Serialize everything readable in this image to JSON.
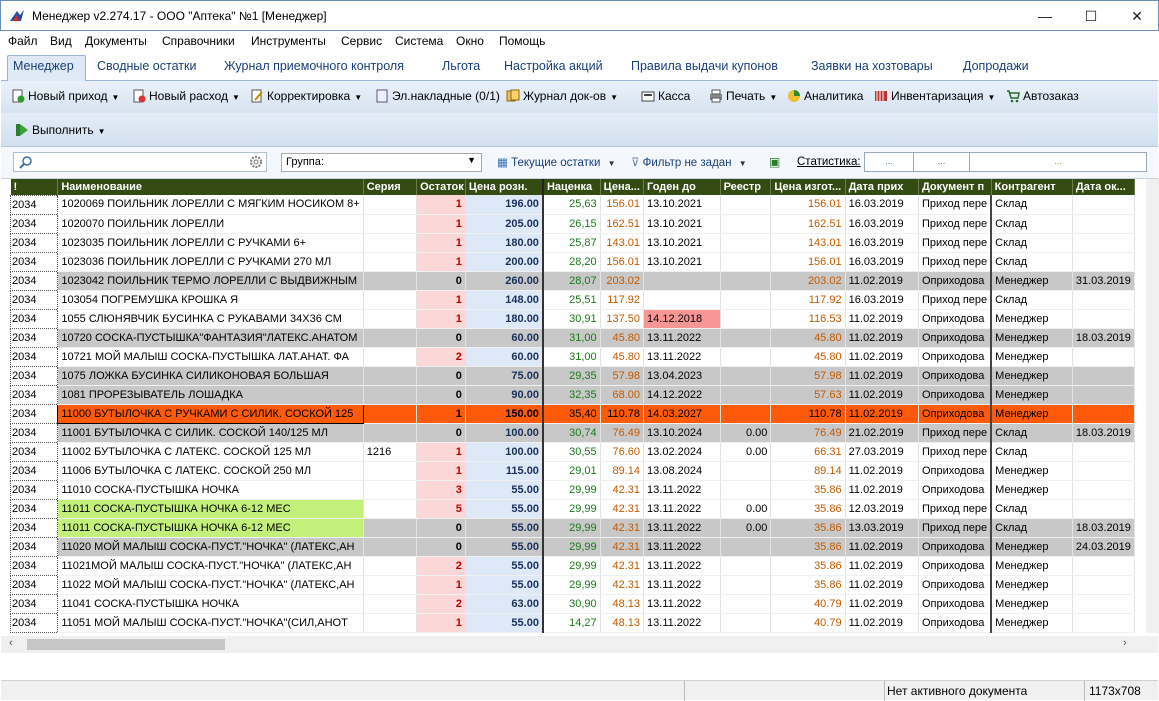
{
  "window": {
    "title": "Менеджер v2.274.17 - ООО \"Аптека\" №1 [Менеджер]",
    "minimize": "—",
    "maximize": "☐",
    "close": "✕"
  },
  "menu": [
    "Файл",
    "Вид",
    "Документы",
    "Справочники",
    "Инструменты",
    "Сервис",
    "Система",
    "Окно",
    "Помощь"
  ],
  "tabs": [
    "Менеджер",
    "Сводные остатки",
    "Журнал приемочного контроля",
    "Льгота",
    "Настройка акций",
    "Правила выдачи купонов",
    "Заявки на хозтовары",
    "Допродажи"
  ],
  "toolbar": {
    "new_income": "Новый приход",
    "new_expense": "Новый расход",
    "correction": "Корректировка",
    "el_invoices": "Эл.накладные (0/1)",
    "doc_journal": "Журнал док-ов",
    "cash": "Касса",
    "print": "Печать",
    "analytics": "Аналитика",
    "inventory": "Инвентаризация",
    "autoorder": "Автозаказ",
    "execute": "Выполнить"
  },
  "filters": {
    "search_value": "",
    "group_label": "Группа:",
    "current_stock": "Текущие остатки",
    "filter": "Фильтр не задан",
    "stats_label": "Статистика:",
    "stat1": "...",
    "stat2": "...",
    "stat3": "..."
  },
  "columns": [
    "!",
    "Наименование",
    "Серия",
    "Остаток",
    "Цена розн.",
    "Наценка",
    "Цена...",
    "Годен до",
    "Реестр",
    "Цена изгот...",
    "Дата прих",
    "Документ п",
    "Контрагент",
    "Дата ок..."
  ],
  "rows": [
    {
      "flag": "2034",
      "name": "1020069 ПОИЛЬНИК ЛОРЕЛЛИ С МЯГКИМ НОСИКОМ 8+",
      "series": "",
      "stock": "1",
      "price": "196.00",
      "markup": "25,63",
      "cost": "156.01",
      "expiry": "13.10.2021",
      "reg": "",
      "mprice": "156.01",
      "date": "16.03.2019",
      "doc": "Приход пере",
      "agent": "Склад",
      "dok": "",
      "style": ""
    },
    {
      "flag": "2034",
      "name": "1020070 ПОИЛЬНИК ЛОРЕЛЛИ",
      "series": "",
      "stock": "1",
      "price": "205.00",
      "markup": "26,15",
      "cost": "162.51",
      "expiry": "13.10.2021",
      "reg": "",
      "mprice": "162.51",
      "date": "16.03.2019",
      "doc": "Приход пере",
      "agent": "Склад",
      "dok": "",
      "style": ""
    },
    {
      "flag": "2034",
      "name": "1023035 ПОИЛЬНИК ЛОРЕЛЛИ С РУЧКАМИ 6+",
      "series": "",
      "stock": "1",
      "price": "180.00",
      "markup": "25,87",
      "cost": "143.01",
      "expiry": "13.10.2021",
      "reg": "",
      "mprice": "143.01",
      "date": "16.03.2019",
      "doc": "Приход пере",
      "agent": "Склад",
      "dok": "",
      "style": ""
    },
    {
      "flag": "2034",
      "name": "1023036 ПОИЛЬНИК ЛОРЕЛЛИ С РУЧКАМИ 270 МЛ",
      "series": "",
      "stock": "1",
      "price": "200.00",
      "markup": "28,20",
      "cost": "156.01",
      "expiry": "13.10.2021",
      "reg": "",
      "mprice": "156.01",
      "date": "16.03.2019",
      "doc": "Приход пере",
      "agent": "Склад",
      "dok": "",
      "style": ""
    },
    {
      "flag": "2034",
      "name": "1023042 ПОИЛЬНИК ТЕРМО ЛОРЕЛЛИ С ВЫДВИЖНЫМ",
      "series": "",
      "stock": "0",
      "price": "260.00",
      "markup": "28,07",
      "cost": "203.02",
      "expiry": "",
      "reg": "",
      "mprice": "203.02",
      "date": "11.02.2019",
      "doc": "Оприходова",
      "agent": "Менеджер",
      "dok": "31.03.2019",
      "style": "gray"
    },
    {
      "flag": "2034",
      "name": "103054 ПОГРЕМУШКА КРОШКА Я",
      "series": "",
      "stock": "1",
      "price": "148.00",
      "markup": "25,51",
      "cost": "117.92",
      "expiry": "",
      "reg": "",
      "mprice": "117.92",
      "date": "16.03.2019",
      "doc": "Приход пере",
      "agent": "Склад",
      "dok": "",
      "style": ""
    },
    {
      "flag": "2034",
      "name": "1055 СЛЮНЯВЧИК БУСИНКА С РУКАВАМИ 34Х36 СМ",
      "series": "",
      "stock": "1",
      "price": "180.00",
      "markup": "30,91",
      "cost": "137.50",
      "expiry": "14.12.2018",
      "reg": "",
      "mprice": "116.53",
      "date": "11.02.2019",
      "doc": "Оприходова",
      "agent": "Менеджер",
      "dok": "",
      "style": "expired"
    },
    {
      "flag": "2034",
      "name": "10720 СОСКА-ПУСТЫШКА\"ФАНТАЗИЯ\"ЛАТЕКС.АНАТОМ",
      "series": "",
      "stock": "0",
      "price": "60.00",
      "markup": "31,00",
      "cost": "45.80",
      "expiry": "13.11.2022",
      "reg": "",
      "mprice": "45.80",
      "date": "11.02.2019",
      "doc": "Оприходова",
      "agent": "Менеджер",
      "dok": "18.03.2019",
      "style": "gray"
    },
    {
      "flag": "2034",
      "name": "10721 МОЙ МАЛЫШ СОСКА-ПУСТЫШКА ЛАТ.АНАТ. ФА",
      "series": "",
      "stock": "2",
      "price": "60.00",
      "markup": "31,00",
      "cost": "45.80",
      "expiry": "13.11.2022",
      "reg": "",
      "mprice": "45.80",
      "date": "11.02.2019",
      "doc": "Оприходова",
      "agent": "Менеджер",
      "dok": "",
      "style": ""
    },
    {
      "flag": "2034",
      "name": "1075 ЛОЖКА БУСИНКА СИЛИКОНОВАЯ БОЛЬШАЯ",
      "series": "",
      "stock": "0",
      "price": "75.00",
      "markup": "29,35",
      "cost": "57.98",
      "expiry": "13.04.2023",
      "reg": "",
      "mprice": "57.98",
      "date": "11.02.2019",
      "doc": "Оприходова",
      "agent": "Менеджер",
      "dok": "",
      "style": "gray"
    },
    {
      "flag": "2034",
      "name": "1081 ПРОРЕЗЫВАТЕЛЬ ЛОШАДКА",
      "series": "",
      "stock": "0",
      "price": "90.00",
      "markup": "32,35",
      "cost": "68.00",
      "expiry": "14.12.2022",
      "reg": "",
      "mprice": "57.63",
      "date": "11.02.2019",
      "doc": "Оприходова",
      "agent": "Менеджер",
      "dok": "",
      "style": "gray"
    },
    {
      "flag": "2034",
      "name": "11000 БУТЫЛОЧКА С РУЧКАМИ С СИЛИК. СОСКОЙ 125",
      "series": "",
      "stock": "1",
      "price": "150.00",
      "markup": "35,40",
      "cost": "110.78",
      "expiry": "14.03.2027",
      "reg": "",
      "mprice": "110.78",
      "date": "11.02.2019",
      "doc": "Оприходова",
      "agent": "Менеджер",
      "dok": "",
      "style": "sel"
    },
    {
      "flag": "2034",
      "name": "11001 БУТЫЛОЧКА С СИЛИК. СОСКОЙ 140/125 МЛ",
      "series": "",
      "stock": "0",
      "price": "100.00",
      "markup": "30,74",
      "cost": "76.49",
      "expiry": "13.10.2024",
      "reg": "0.00",
      "mprice": "76.49",
      "date": "21.02.2019",
      "doc": "Приход пере",
      "agent": "Склад",
      "dok": "18.03.2019",
      "style": "gray"
    },
    {
      "flag": "2034",
      "name": "11002 БУТЫЛОЧКА С ЛАТЕКС. СОСКОЙ 125  МЛ",
      "series": "1216",
      "stock": "1",
      "price": "100.00",
      "markup": "30,55",
      "cost": "76.60",
      "expiry": "13.02.2024",
      "reg": "0.00",
      "mprice": "66.31",
      "date": "27.03.2019",
      "doc": "Приход пере",
      "agent": "Склад",
      "dok": "",
      "style": ""
    },
    {
      "flag": "2034",
      "name": "11006 БУТЫЛОЧКА С ЛАТЕКС. СОСКОЙ 250 МЛ",
      "series": "",
      "stock": "1",
      "price": "115.00",
      "markup": "29,01",
      "cost": "89.14",
      "expiry": "13.08.2024",
      "reg": "",
      "mprice": "89.14",
      "date": "11.02.2019",
      "doc": "Оприходова",
      "agent": "Менеджер",
      "dok": "",
      "style": ""
    },
    {
      "flag": "2034",
      "name": "11010 СОСКА-ПУСТЫШКА НОЧКА",
      "series": "",
      "stock": "3",
      "price": "55.00",
      "markup": "29,99",
      "cost": "42.31",
      "expiry": "13.11.2022",
      "reg": "",
      "mprice": "35.86",
      "date": "11.02.2019",
      "doc": "Оприходова",
      "agent": "Менеджер",
      "dok": "",
      "style": ""
    },
    {
      "flag": "2034",
      "name": "11011 СОСКА-ПУСТЫШКА НОЧКА 6-12 МЕС",
      "series": "",
      "stock": "5",
      "price": "55.00",
      "markup": "29,99",
      "cost": "42.31",
      "expiry": "13.11.2022",
      "reg": "0.00",
      "mprice": "35.86",
      "date": "12.03.2019",
      "doc": "Приход пере",
      "agent": "Склад",
      "dok": "",
      "style": "greenname"
    },
    {
      "flag": "2034",
      "name": "11011 СОСКА-ПУСТЫШКА НОЧКА 6-12 МЕС",
      "series": "",
      "stock": "0",
      "price": "55.00",
      "markup": "29,99",
      "cost": "42.31",
      "expiry": "13.11.2022",
      "reg": "0.00",
      "mprice": "35.86",
      "date": "13.03.2019",
      "doc": "Приход пере",
      "agent": "Склад",
      "dok": "18.03.2019",
      "style": "gray greenname"
    },
    {
      "flag": "2034",
      "name": "11020 МОЙ МАЛЫШ СОСКА-ПУСТ.\"НОЧКА\" (ЛАТЕКС,АН",
      "series": "",
      "stock": "0",
      "price": "55.00",
      "markup": "29,99",
      "cost": "42.31",
      "expiry": "13.11.2022",
      "reg": "",
      "mprice": "35.86",
      "date": "11.02.2019",
      "doc": "Оприходова",
      "agent": "Менеджер",
      "dok": "24.03.2019",
      "style": "gray"
    },
    {
      "flag": "2034",
      "name": "11021МОЙ МАЛЫШ СОСКА-ПУСТ.\"НОЧКА\" (ЛАТЕКС,АН",
      "series": "",
      "stock": "2",
      "price": "55.00",
      "markup": "29,99",
      "cost": "42.31",
      "expiry": "13.11.2022",
      "reg": "",
      "mprice": "35.86",
      "date": "11.02.2019",
      "doc": "Оприходова",
      "agent": "Менеджер",
      "dok": "",
      "style": ""
    },
    {
      "flag": "2034",
      "name": "11022 МОЙ МАЛЫШ СОСКА-ПУСТ.\"НОЧКА\" (ЛАТЕКС,АН",
      "series": "",
      "stock": "1",
      "price": "55.00",
      "markup": "29,99",
      "cost": "42.31",
      "expiry": "13.11.2022",
      "reg": "",
      "mprice": "35.86",
      "date": "11.02.2019",
      "doc": "Оприходова",
      "agent": "Менеджер",
      "dok": "",
      "style": ""
    },
    {
      "flag": "2034",
      "name": "11041 СОСКА-ПУСТЫШКА НОЧКА",
      "series": "",
      "stock": "2",
      "price": "63.00",
      "markup": "30,90",
      "cost": "48.13",
      "expiry": "13.11.2022",
      "reg": "",
      "mprice": "40.79",
      "date": "11.02.2019",
      "doc": "Оприходова",
      "agent": "Менеджер",
      "dok": "",
      "style": ""
    },
    {
      "flag": "2034",
      "name": "11051 МОЙ МАЛЫШ СОСКА-ПУСТ.\"НОЧКА\"(СИЛ,АНОТ",
      "series": "",
      "stock": "1",
      "price": "55.00",
      "markup": "14,27",
      "cost": "48.13",
      "expiry": "13.11.2022",
      "reg": "",
      "mprice": "40.79",
      "date": "11.02.2019",
      "doc": "Оприходова",
      "agent": "Менеджер",
      "dok": "",
      "style": ""
    }
  ],
  "status": {
    "active_doc": "Нет активного документа",
    "resolution": "1173x708"
  },
  "colors": {
    "header_bg": "#344c13",
    "selected_row": "#ff5a0a",
    "zero_stock_row": "#c8c8c8",
    "stock_cell": "#fcd7d7",
    "price_cell": "#dde9f7"
  }
}
